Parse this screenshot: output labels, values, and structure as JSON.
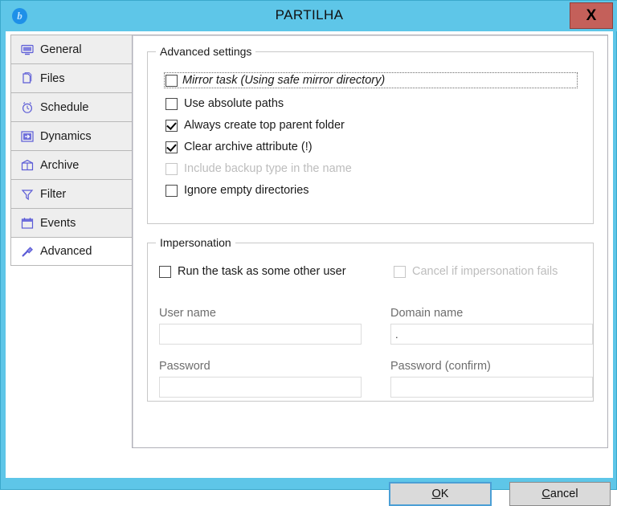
{
  "window": {
    "title": "PARTILHA",
    "app_icon": "b",
    "close_label": "X",
    "accent_color": "#5ec6e8",
    "close_color": "#c4605a"
  },
  "sidebar": {
    "items": [
      {
        "label": "General",
        "icon": "monitor-icon",
        "selected": false
      },
      {
        "label": "Files",
        "icon": "files-icon",
        "selected": false
      },
      {
        "label": "Schedule",
        "icon": "alarm-clock-icon",
        "selected": false
      },
      {
        "label": "Dynamics",
        "icon": "arrow-box-icon",
        "selected": false
      },
      {
        "label": "Archive",
        "icon": "archive-box-icon",
        "selected": false
      },
      {
        "label": "Filter",
        "icon": "funnel-icon",
        "selected": false
      },
      {
        "label": "Events",
        "icon": "calendar-icon",
        "selected": false
      },
      {
        "label": "Advanced",
        "icon": "screwdriver-icon",
        "selected": true
      }
    ]
  },
  "advanced_settings": {
    "title": "Advanced settings",
    "checkboxes": [
      {
        "label": "Mirror task (Using safe mirror directory)",
        "checked": false,
        "disabled": false,
        "italic": true,
        "focused": true
      },
      {
        "label": "Use absolute paths",
        "checked": false,
        "disabled": false,
        "italic": false,
        "focused": false
      },
      {
        "label": "Always create top parent folder",
        "checked": true,
        "disabled": false,
        "italic": false,
        "focused": false
      },
      {
        "label": "Clear archive attribute (!)",
        "checked": true,
        "disabled": false,
        "italic": false,
        "focused": false
      },
      {
        "label": "Include backup type in the name",
        "checked": false,
        "disabled": true,
        "italic": false,
        "focused": false
      },
      {
        "label": "Ignore empty directories",
        "checked": false,
        "disabled": false,
        "italic": false,
        "focused": false
      }
    ]
  },
  "impersonation": {
    "title": "Impersonation",
    "run_as_other_user": {
      "label": "Run the task as some other user",
      "checked": false,
      "disabled": false
    },
    "cancel_if_fails": {
      "label": "Cancel if impersonation fails",
      "checked": false,
      "disabled": true
    },
    "fields": {
      "user_name": {
        "label": "User name",
        "value": "",
        "placeholder": ""
      },
      "domain_name": {
        "label": "Domain name",
        "value": ".",
        "placeholder": ""
      },
      "password": {
        "label": "Password",
        "value": "",
        "placeholder": ""
      },
      "password_confirm": {
        "label": "Password (confirm)",
        "value": "",
        "placeholder": ""
      }
    }
  },
  "buttons": {
    "ok": {
      "accel": "O",
      "rest": "K"
    },
    "cancel": {
      "accel": "C",
      "rest": "ancel"
    }
  }
}
